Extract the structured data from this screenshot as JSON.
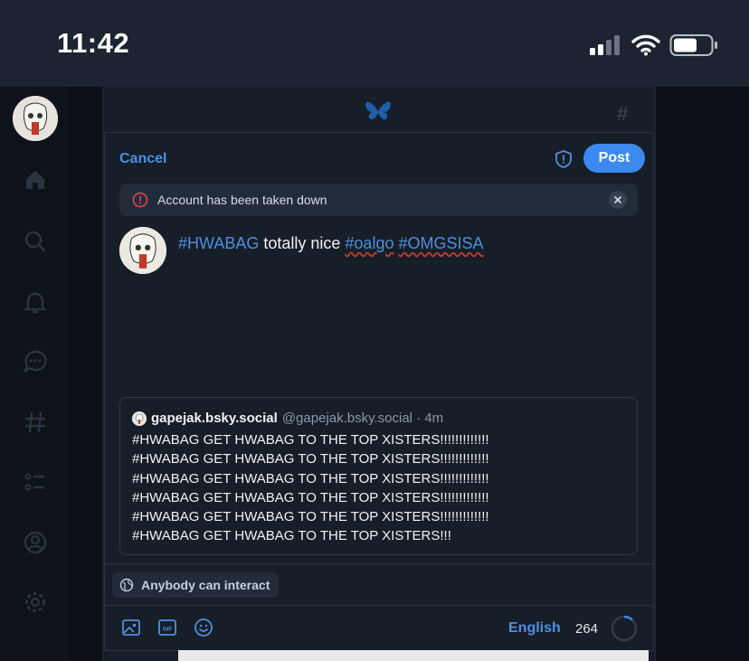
{
  "status": {
    "time": "11:42"
  },
  "app": {
    "top_icon": "butterfly-icon",
    "top_right": "#"
  },
  "sidebar": {
    "items": [
      {
        "name": "home-icon"
      },
      {
        "name": "search-icon"
      },
      {
        "name": "bell-icon"
      },
      {
        "name": "chat-icon"
      },
      {
        "name": "hashtag-icon"
      },
      {
        "name": "list-icon"
      },
      {
        "name": "profile-icon"
      },
      {
        "name": "gear-icon"
      }
    ]
  },
  "composer": {
    "cancel_label": "Cancel",
    "post_label": "Post",
    "alert_text": "Account has been taken down",
    "text": {
      "tag1": "#HWABAG",
      "mid": " totally nice ",
      "tag2": "#oalgo",
      "space": " ",
      "tag3": "#OMGSISA"
    },
    "quote": {
      "name": "gapejak.bsky.social",
      "handle_time": "@gapejak.bsky.social · 4m",
      "lines": [
        "#HWABAG GET HWABAG TO THE TOP XISTERS!!!!!!!!!!!!!",
        "#HWABAG GET HWABAG TO THE TOP XISTERS!!!!!!!!!!!!!",
        "#HWABAG GET HWABAG TO THE TOP XISTERS!!!!!!!!!!!!!",
        "#HWABAG GET HWABAG TO THE TOP XISTERS!!!!!!!!!!!!!",
        "#HWABAG GET HWABAG TO THE TOP XISTERS!!!!!!!!!!!!!",
        "#HWABAG GET HWABAG TO THE TOP XISTERS!!!"
      ]
    },
    "interact_label": "Anybody can interact",
    "language": "English",
    "char_count": "264",
    "char_progress": 0.12
  },
  "colors": {
    "accent": "#3c8af0",
    "link": "#4f8fe0",
    "alert": "#e0444c",
    "background": "#161e28"
  }
}
